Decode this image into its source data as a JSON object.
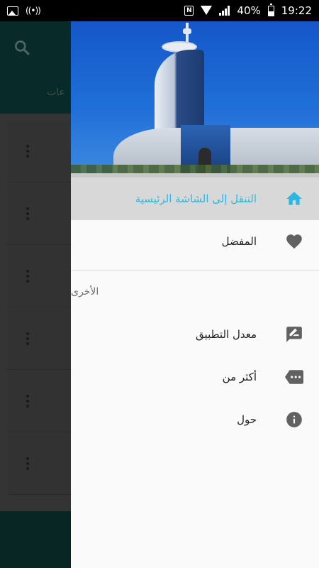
{
  "status_bar": {
    "battery": "40%",
    "time": "19:22",
    "icons": [
      "image-icon",
      "radio-icon",
      "nfc-icon",
      "wifi-icon",
      "signal-icon",
      "battery-icon"
    ]
  },
  "background": {
    "tab_partial": "عات"
  },
  "drawer": {
    "header_image": "hotel-tower-photo",
    "items": [
      {
        "label": "التنقل إلى الشاشة الرئيسية",
        "icon": "home-icon",
        "active": true
      },
      {
        "label": "المفضل",
        "icon": "heart-icon"
      }
    ],
    "section_title": "الأخرى",
    "other_items": [
      {
        "label": "معدل التطبيق",
        "icon": "rate-edit-icon"
      },
      {
        "label": "أكثر من",
        "icon": "more-label-icon"
      },
      {
        "label": "حول",
        "icon": "info-icon"
      }
    ]
  },
  "colors": {
    "accent": "#2cb7e3",
    "icon": "#616161",
    "toolbar": "#0e4f4a"
  }
}
